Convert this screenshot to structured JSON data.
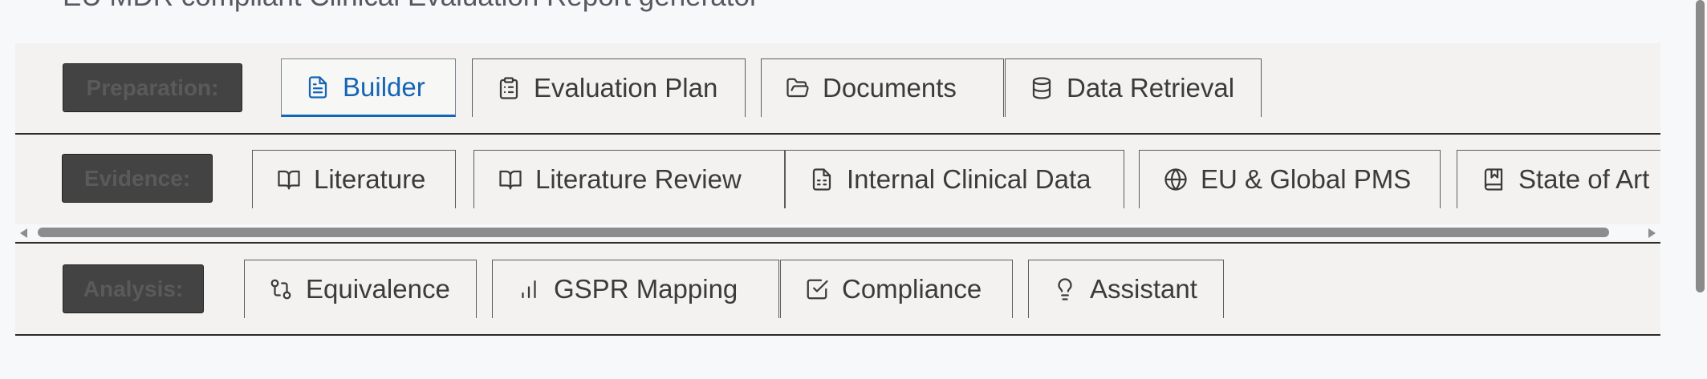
{
  "subtitle": "EU MDR compliant Clinical Evaluation Report generator",
  "rows": {
    "preparation": {
      "label": "Preparation:",
      "tabs": [
        {
          "label": "Builder",
          "icon": "file-text-icon",
          "active": true
        },
        {
          "label": "Evaluation Plan",
          "icon": "clipboard-list-icon"
        },
        {
          "label": "Documents",
          "icon": "folder-open-icon"
        },
        {
          "label": "Data Retrieval",
          "icon": "database-icon"
        }
      ]
    },
    "evidence": {
      "label": "Evidence:",
      "tabs": [
        {
          "label": "Literature",
          "icon": "book-open-icon"
        },
        {
          "label": "Literature Review",
          "icon": "book-open-icon"
        },
        {
          "label": "Internal Clinical Data",
          "icon": "file-spreadsheet-icon"
        },
        {
          "label": "EU & Global PMS",
          "icon": "globe-icon"
        },
        {
          "label": "State of Art",
          "icon": "bookmark-book-icon"
        }
      ]
    },
    "analysis": {
      "label": "Analysis:",
      "tabs": [
        {
          "label": "Equivalence",
          "icon": "git-compare-icon"
        },
        {
          "label": "GSPR Mapping",
          "icon": "bar-chart-icon"
        },
        {
          "label": "Compliance",
          "icon": "check-square-icon"
        },
        {
          "label": "Assistant",
          "icon": "lightbulb-icon"
        }
      ]
    }
  },
  "colors": {
    "active_tab": "#1565b5",
    "tab_text": "#3b3b3b",
    "label_box_bg": "#434343",
    "row_bg": "#f3f2f0",
    "page_bg": "#f7f8fa"
  }
}
